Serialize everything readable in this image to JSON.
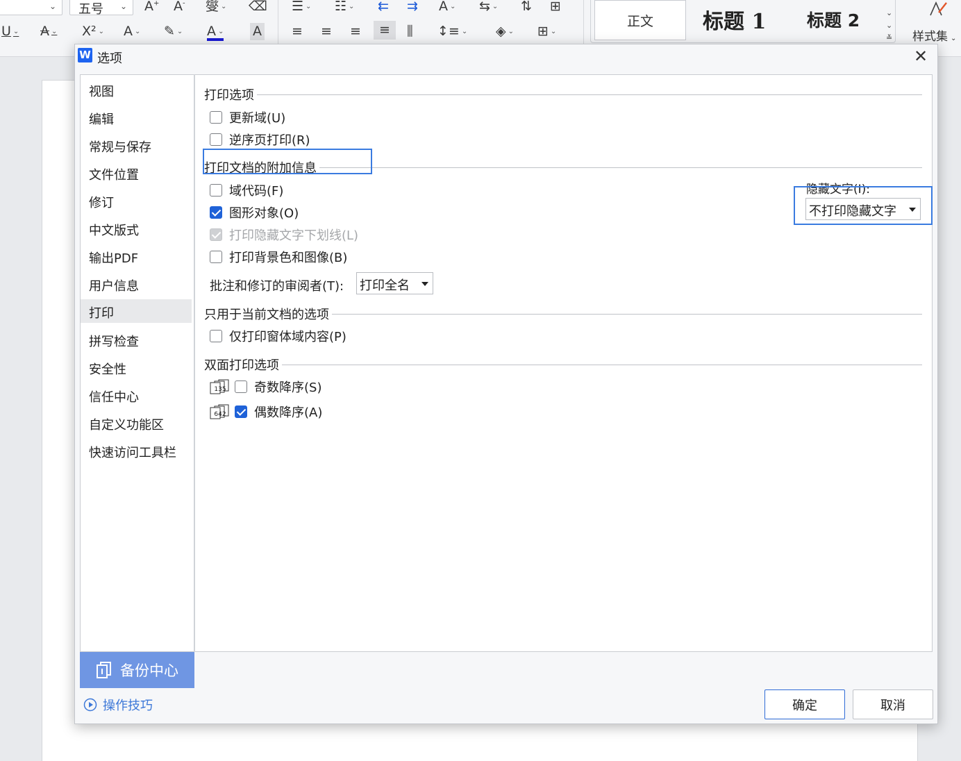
{
  "ribbon": {
    "font_size_value": "五号",
    "style_normal": "正文",
    "style_h1": "标题 1",
    "style_h2": "标题 2",
    "styleset_label": "样式集"
  },
  "dialog": {
    "logo_letter": "W",
    "title": "选项",
    "close_glyph": "✕"
  },
  "nav": {
    "items": [
      {
        "label": "视图"
      },
      {
        "label": "编辑"
      },
      {
        "label": "常规与保存"
      },
      {
        "label": "文件位置"
      },
      {
        "label": "修订"
      },
      {
        "label": "中文版式"
      },
      {
        "label": "输出PDF"
      },
      {
        "label": "用户信息"
      },
      {
        "label": "打印",
        "active": true
      },
      {
        "label": "拼写检查"
      },
      {
        "label": "安全性"
      },
      {
        "label": "信任中心"
      },
      {
        "label": "自定义功能区"
      },
      {
        "label": "快速访问工具栏"
      }
    ],
    "backup_center": "备份中心",
    "tips": "操作技巧"
  },
  "print": {
    "section_print_options": "打印选项",
    "update_fields": {
      "label": "更新域(U)",
      "checked": false
    },
    "reverse_order": {
      "label": "逆序页打印(R)",
      "checked": false
    },
    "section_extra_info": "打印文档的附加信息",
    "field_codes": {
      "label": "域代码(F)",
      "checked": false
    },
    "drawing_objects": {
      "label": "图形对象(O)",
      "checked": true
    },
    "hidden_text_underline": {
      "label": "打印隐藏文字下划线(L)",
      "checked": true,
      "disabled": true
    },
    "background": {
      "label": "打印背景色和图像(B)",
      "checked": false
    },
    "reviewer_label": "批注和修订的审阅者(T):",
    "reviewer_value": "打印全名",
    "hidden_text_label": "隐藏文字(I):",
    "hidden_text_value": "不打印隐藏文字",
    "section_current_doc": "只用于当前文档的选项",
    "form_fields_only": {
      "label": "仅打印窗体域内容(P)",
      "checked": false
    },
    "section_duplex": "双面打印选项",
    "odd_desc": {
      "label": "奇数降序(S)",
      "checked": false,
      "icon_digits": "135"
    },
    "even_desc": {
      "label": "偶数降序(A)",
      "checked": true,
      "icon_digits": "642"
    }
  },
  "buttons": {
    "ok": "确定",
    "cancel": "取消"
  },
  "colors": {
    "accent": "#1f62d8",
    "highlight": "#3a7be0",
    "backup_bg": "#6f96e3"
  }
}
